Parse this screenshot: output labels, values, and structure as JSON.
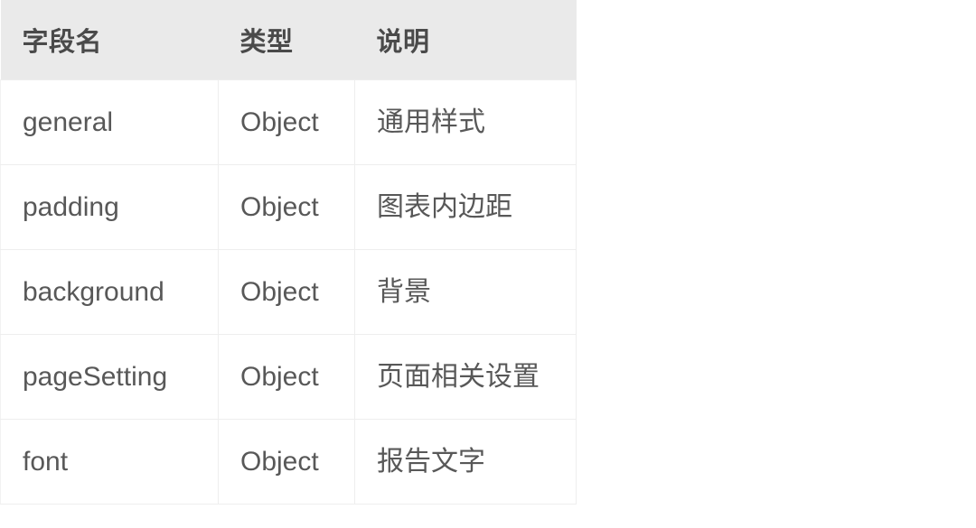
{
  "table": {
    "columns": [
      {
        "key": "name",
        "label": "字段名"
      },
      {
        "key": "type",
        "label": "类型"
      },
      {
        "key": "desc",
        "label": "说明"
      }
    ],
    "rows": [
      {
        "name": "general",
        "type": "Object",
        "desc": "通用样式"
      },
      {
        "name": "padding",
        "type": "Object",
        "desc": "图表内边距"
      },
      {
        "name": "background",
        "type": "Object",
        "desc": "背景"
      },
      {
        "name": "pageSetting",
        "type": "Object",
        "desc": "页面相关设置"
      },
      {
        "name": "font",
        "type": "Object",
        "desc": "报告文字"
      }
    ],
    "colors": {
      "header_background": "#eaeaea",
      "header_text": "#4a4a4a",
      "body_background": "#ffffff",
      "body_text": "#585858",
      "border": "#eeeeee",
      "page_background": "#ffffff"
    }
  }
}
